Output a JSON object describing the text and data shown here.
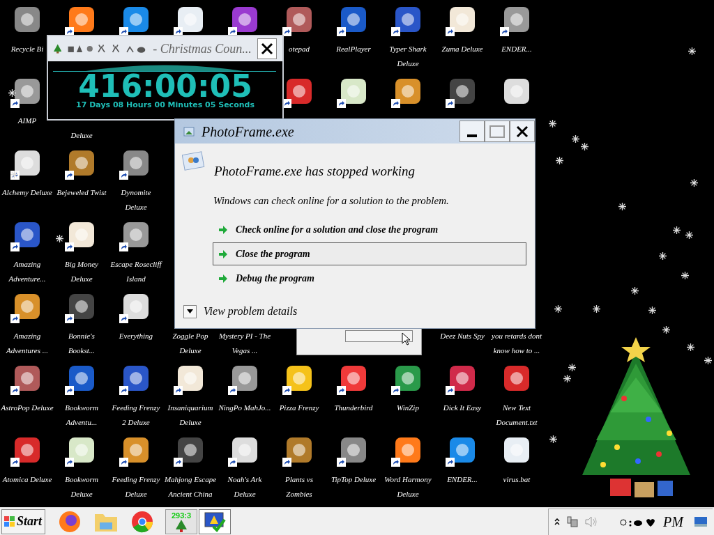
{
  "desktop": {
    "icon_rows": [
      [
        {
          "kind": "app",
          "label": "Recycle Bi",
          "shortcut": false
        },
        {
          "kind": "app",
          "shortcut": true
        },
        {
          "kind": "app",
          "shortcut": true
        },
        {
          "kind": "app",
          "shortcut": true
        },
        {
          "kind": "app",
          "shortcut": true
        },
        {
          "kind": "app",
          "label": "otepad",
          "shortcut": true
        },
        {
          "kind": "app",
          "label": "RealPlayer",
          "shortcut": true
        },
        {
          "kind": "app",
          "label": "Typer Shark Deluxe",
          "shortcut": true
        },
        {
          "kind": "app",
          "label": "Zuma Deluxe",
          "shortcut": true
        },
        {
          "kind": "app",
          "label": "ENDER...",
          "shortcut": true
        }
      ],
      [
        {
          "kind": "app",
          "label": "AIMP",
          "shortcut": true
        },
        {
          "kind": "label_tail",
          "label": "Deluxe"
        },
        {
          "kind": "empty"
        },
        {
          "kind": "empty"
        },
        {
          "kind": "empty"
        },
        {
          "kind": "app",
          "shortcut": true
        },
        {
          "kind": "app",
          "shortcut": true
        },
        {
          "kind": "app",
          "shortcut": true
        },
        {
          "kind": "app",
          "shortcut": true
        },
        {
          "kind": "app",
          "shortcut": false
        }
      ],
      [
        {
          "kind": "app",
          "label": "Alchemy Deluxe",
          "shortcut": true
        },
        {
          "kind": "app",
          "label": "Bejeweled Twist",
          "shortcut": true
        },
        {
          "kind": "app",
          "label": "Dynomite Deluxe",
          "shortcut": true
        },
        {
          "kind": "empty"
        },
        {
          "kind": "empty"
        },
        {
          "kind": "empty"
        },
        {
          "kind": "empty"
        },
        {
          "kind": "empty"
        },
        {
          "kind": "empty"
        },
        {
          "kind": "empty"
        }
      ],
      [
        {
          "kind": "app",
          "label": "Amazing Adventure...",
          "shortcut": true
        },
        {
          "kind": "app",
          "label": "Big Money Deluxe",
          "shortcut": true
        },
        {
          "kind": "app",
          "label": "Escape Rosecliff Island",
          "shortcut": true
        },
        {
          "kind": "empty"
        },
        {
          "kind": "empty"
        },
        {
          "kind": "empty"
        },
        {
          "kind": "empty"
        },
        {
          "kind": "empty"
        },
        {
          "kind": "empty"
        },
        {
          "kind": "empty"
        }
      ],
      [
        {
          "kind": "app",
          "label": "Amazing Adventures ...",
          "shortcut": true
        },
        {
          "kind": "app",
          "label": "Bonnie's Bookst...",
          "shortcut": true
        },
        {
          "kind": "app",
          "label": "Everything",
          "shortcut": true
        },
        {
          "kind": "label",
          "label": "Zoggle Pop Deluxe"
        },
        {
          "kind": "label",
          "label": "Mystery PI - The Vegas ..."
        },
        {
          "kind": "empty"
        },
        {
          "kind": "empty"
        },
        {
          "kind": "empty"
        },
        {
          "kind": "label",
          "label": "Deez Nuts Spy"
        },
        {
          "kind": "label",
          "label": "you retards dont know how to ..."
        }
      ],
      [
        {
          "kind": "app",
          "label": "AstroPop Deluxe",
          "shortcut": true
        },
        {
          "kind": "app",
          "label": "Bookworm Adventu...",
          "shortcut": true
        },
        {
          "kind": "app",
          "label": "Feeding Frenzy 2 Deluxe",
          "shortcut": true
        },
        {
          "kind": "app",
          "label": "Insaniquarium Deluxe",
          "shortcut": true
        },
        {
          "kind": "app",
          "label": "NingPo MahJo...",
          "shortcut": true
        },
        {
          "kind": "app",
          "label": "Pizza Frenzy",
          "shortcut": true
        },
        {
          "kind": "app",
          "label": "Thunderbird",
          "shortcut": true
        },
        {
          "kind": "app",
          "label": "WinZip",
          "shortcut": true
        },
        {
          "kind": "app",
          "label": "Dick It Easy",
          "shortcut": true
        },
        {
          "kind": "app",
          "label": "New Text Document.txt",
          "shortcut": false
        }
      ],
      [
        {
          "kind": "app",
          "label": "Atomica Deluxe",
          "shortcut": true
        },
        {
          "kind": "app",
          "label": "Bookworm Deluxe",
          "shortcut": true
        },
        {
          "kind": "app",
          "label": "Feeding Frenzy Deluxe",
          "shortcut": true
        },
        {
          "kind": "app",
          "label": "Mahjong Escape Ancient China",
          "shortcut": true
        },
        {
          "kind": "app",
          "label": "Noah's Ark Deluxe",
          "shortcut": true
        },
        {
          "kind": "app",
          "label": "Plants vs Zombies",
          "shortcut": true
        },
        {
          "kind": "app",
          "label": "TipTop Deluxe",
          "shortcut": true
        },
        {
          "kind": "app",
          "label": "Word Harmony Deluxe",
          "shortcut": true
        },
        {
          "kind": "app",
          "label": "ENDER...",
          "shortcut": true
        },
        {
          "kind": "app",
          "label": "virus.bat",
          "shortcut": false
        }
      ]
    ]
  },
  "countdown_window": {
    "title": "- Christmas Coun...",
    "time": "416:00:05",
    "detail": "17 Days 08 Hours 00 Minutes 05 Seconds"
  },
  "error_dialog": {
    "title": "PhotoFrame.exe",
    "heading": "PhotoFrame.exe has stopped working",
    "message": "Windows can check online for a solution to the problem.",
    "options": [
      {
        "label": "Check online for a solution and close the program",
        "selected": false
      },
      {
        "label": "Close the program",
        "selected": true
      },
      {
        "label": "Debug the program",
        "selected": false
      }
    ],
    "details": {
      "label": "View problem details",
      "expanded": false
    }
  },
  "taskbar": {
    "start": "Start",
    "tasks": [
      {
        "kind": "countdown",
        "label": "293:3",
        "selected": false
      },
      {
        "kind": "error",
        "selected": true
      }
    ],
    "clock": "PM"
  }
}
